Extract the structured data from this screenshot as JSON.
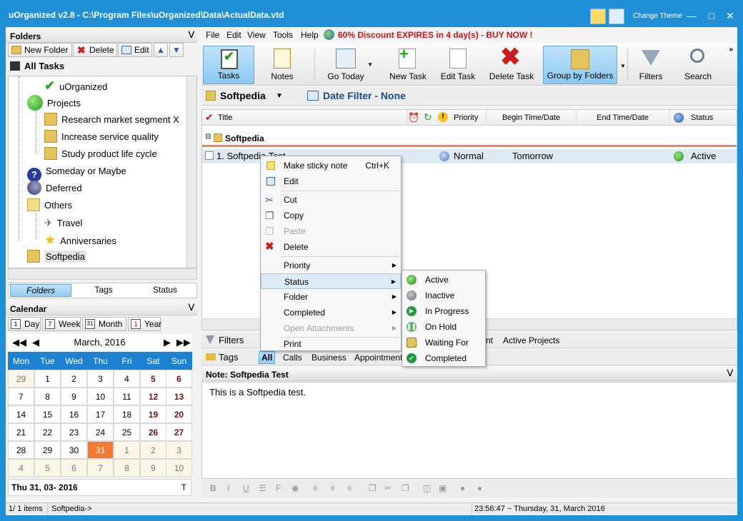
{
  "window": {
    "title": "uOrganized v2.8 - C:\\Program Files\\uOrganized\\Data\\ActualData.vtd",
    "change_theme": "Change Theme"
  },
  "folders_panel": {
    "header": "Folders",
    "buttons": {
      "new_folder": "New Folder",
      "delete": "Delete",
      "edit": "Edit"
    },
    "tree": {
      "root": "All Tasks",
      "items": [
        "uOrganized",
        "Projects",
        "Research market segment X",
        "Increase service quality",
        "Study product life cycle",
        "Someday or Maybe",
        "Deferred",
        "Others",
        "Travel",
        "Anniversaries",
        "Softpedia"
      ]
    },
    "tabs": [
      "Folders",
      "Tags",
      "Status"
    ]
  },
  "calendar": {
    "header": "Calendar",
    "views": [
      "Day",
      "Week",
      "Month",
      "Year"
    ],
    "month_label": "March, 2016",
    "weekdays": [
      "Mon",
      "Tue",
      "Wed",
      "Thu",
      "Fri",
      "Sat",
      "Sun"
    ],
    "weeks": [
      [
        "29",
        "1",
        "2",
        "3",
        "4",
        "5",
        "6"
      ],
      [
        "7",
        "8",
        "9",
        "10",
        "11",
        "12",
        "13"
      ],
      [
        "14",
        "15",
        "16",
        "17",
        "18",
        "19",
        "20"
      ],
      [
        "21",
        "22",
        "23",
        "24",
        "25",
        "26",
        "27"
      ],
      [
        "28",
        "29",
        "30",
        "31",
        "1",
        "2",
        "3"
      ],
      [
        "4",
        "5",
        "6",
        "7",
        "8",
        "9",
        "10"
      ]
    ],
    "selected_date": "Thu 31, 03- 2016",
    "today_btn": "T"
  },
  "menu": {
    "items": [
      "File",
      "Edit",
      "View",
      "Tools",
      "Help"
    ],
    "promo": "60% Discount EXPIRES in 4 day(s) - BUY NOW !"
  },
  "toolbar": {
    "tasks": "Tasks",
    "notes": "Notes",
    "go_today": "Go Today",
    "new_task": "New Task",
    "edit_task": "Edit Task",
    "delete_task": "Delete Task",
    "group_by_folders": "Group by Folders",
    "filters": "Filters",
    "search": "Search"
  },
  "crumb": {
    "folder": "Softpedia",
    "date_filter": "Date Filter - None"
  },
  "grid": {
    "columns": {
      "title": "Title",
      "priority": "Priority",
      "begin": "Begin Time/Date",
      "end": "End Time/Date",
      "status": "Status"
    },
    "group": "Softpedia",
    "row": {
      "title": "1. Softpedia Test",
      "priority": "Normal",
      "begin": "Tomorrow",
      "status": "Active"
    }
  },
  "filters_bar": {
    "label": "Filters",
    "active_projects": "Active Projects",
    "nt": "nt"
  },
  "tags_bar": {
    "label": "Tags",
    "items": [
      "All",
      "Calls",
      "Business",
      "Appointment"
    ]
  },
  "note": {
    "header": "Note: Softpedia Test",
    "body": "This is a Softpedia test."
  },
  "context_menu": {
    "make_sticky": "Make sticky note",
    "make_sticky_key": "Ctrl+K",
    "edit": "Edit",
    "cut": "Cut",
    "copy": "Copy",
    "paste": "Paste",
    "delete": "Delete",
    "priority": "Priority",
    "status": "Status",
    "folder": "Folder",
    "completed": "Completed",
    "open_attachments": "Open Attachments",
    "print": "Print"
  },
  "status_submenu": [
    "Active",
    "Inactive",
    "In Progress",
    "On Hold",
    "Waiting For",
    "Completed"
  ],
  "statusbar": {
    "items": "1/ 1 items",
    "path": "Softpedia->",
    "time": "23:56:47  ~  Thursday, 31, March 2016"
  },
  "colors": {
    "accent": "#1f8fd8",
    "today": "#f47a30"
  }
}
